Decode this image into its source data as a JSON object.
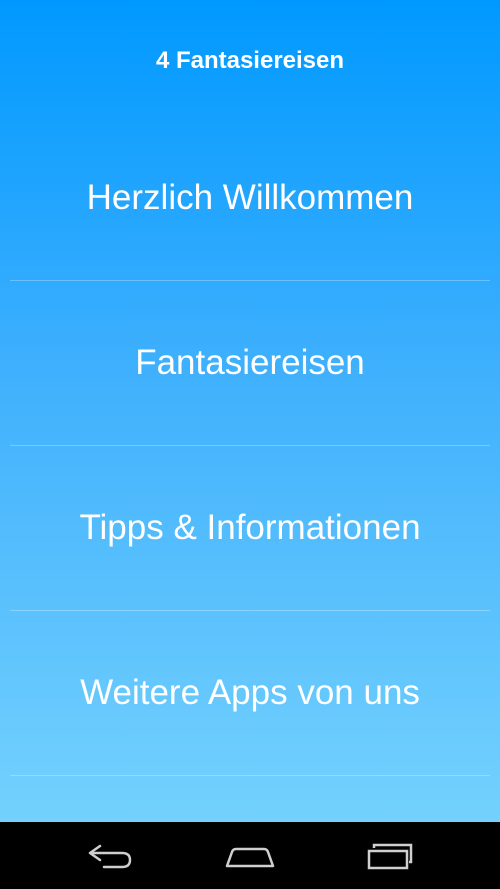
{
  "app": {
    "title": "4 Fantasiereisen"
  },
  "menu": {
    "items": [
      {
        "label": "Herzlich Willkommen"
      },
      {
        "label": "Fantasiereisen"
      },
      {
        "label": "Tipps & Informationen"
      },
      {
        "label": "Weitere Apps von uns"
      }
    ]
  },
  "navbar": {
    "icons": [
      "back-icon",
      "home-icon",
      "recent-apps-icon"
    ]
  },
  "colors": {
    "gradient_top": "#0099ff",
    "gradient_bottom": "#74d1fd",
    "text": "#ffffff",
    "navbar_bg": "#000000"
  }
}
